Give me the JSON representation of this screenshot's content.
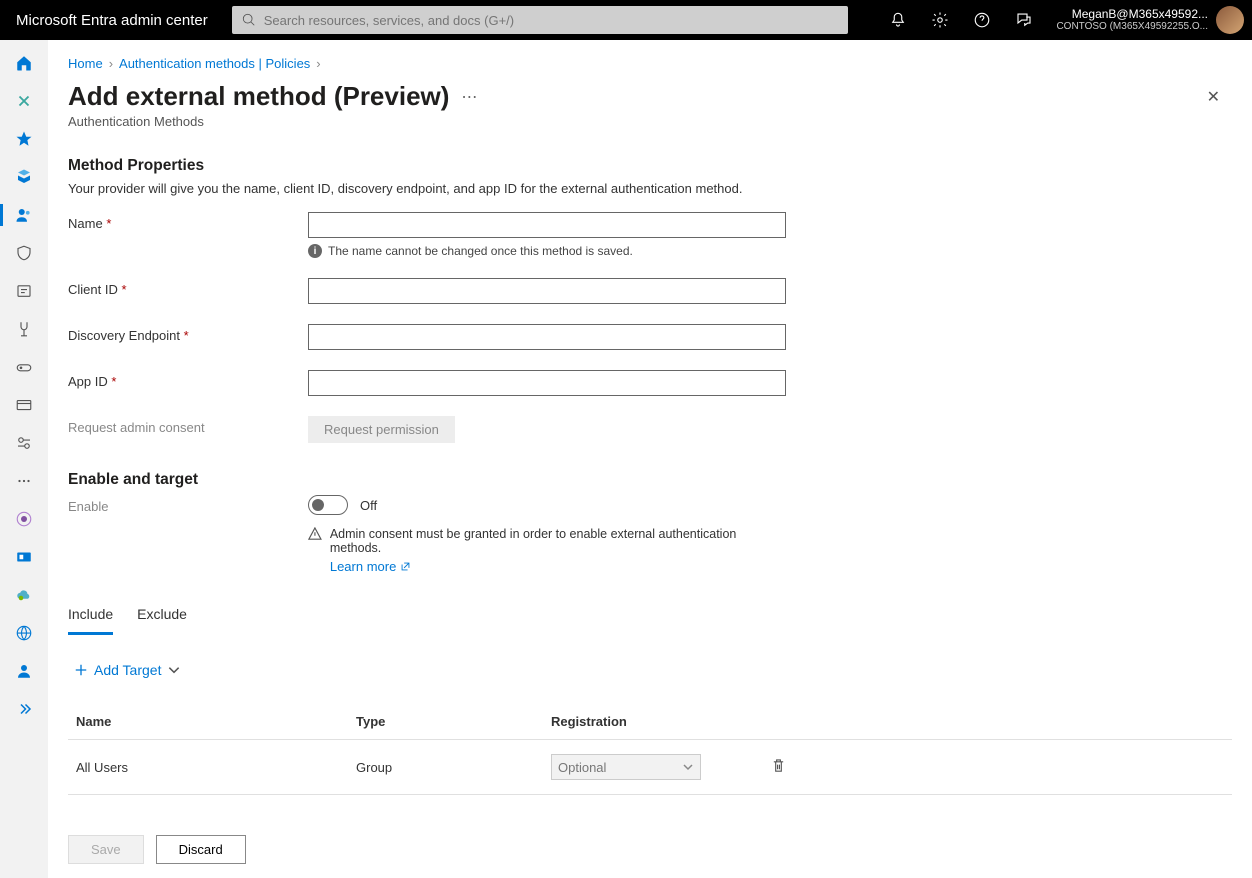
{
  "header": {
    "app_title": "Microsoft Entra admin center",
    "search_placeholder": "Search resources, services, and docs (G+/)",
    "user_name": "MeganB@M365x49592...",
    "org_name": "CONTOSO (M365X49592255.O..."
  },
  "breadcrumb": {
    "home": "Home",
    "page": "Authentication methods | Policies"
  },
  "page": {
    "title": "Add external method (Preview)",
    "subtitle": "Authentication Methods"
  },
  "method_props": {
    "heading": "Method Properties",
    "desc": "Your provider will give you the name, client ID, discovery endpoint, and app ID for the external authentication method.",
    "name_label": "Name",
    "name_value": "",
    "name_help": "The name cannot be changed once this method is saved.",
    "client_id_label": "Client ID",
    "client_id_value": "",
    "discovery_label": "Discovery Endpoint",
    "discovery_value": "",
    "app_id_label": "App ID",
    "app_id_value": "",
    "consent_label": "Request admin consent",
    "consent_button": "Request permission"
  },
  "enable": {
    "heading": "Enable and target",
    "enable_label": "Enable",
    "toggle_state": "Off",
    "warn_text": "Admin consent must be granted in order to enable external authentication methods.",
    "learn_more": "Learn more"
  },
  "tabs": {
    "include": "Include",
    "exclude": "Exclude"
  },
  "targets": {
    "add_label": "Add Target",
    "col_name": "Name",
    "col_type": "Type",
    "col_reg": "Registration",
    "rows": [
      {
        "name": "All Users",
        "type": "Group",
        "reg": "Optional"
      }
    ]
  },
  "footer": {
    "save": "Save",
    "discard": "Discard"
  }
}
